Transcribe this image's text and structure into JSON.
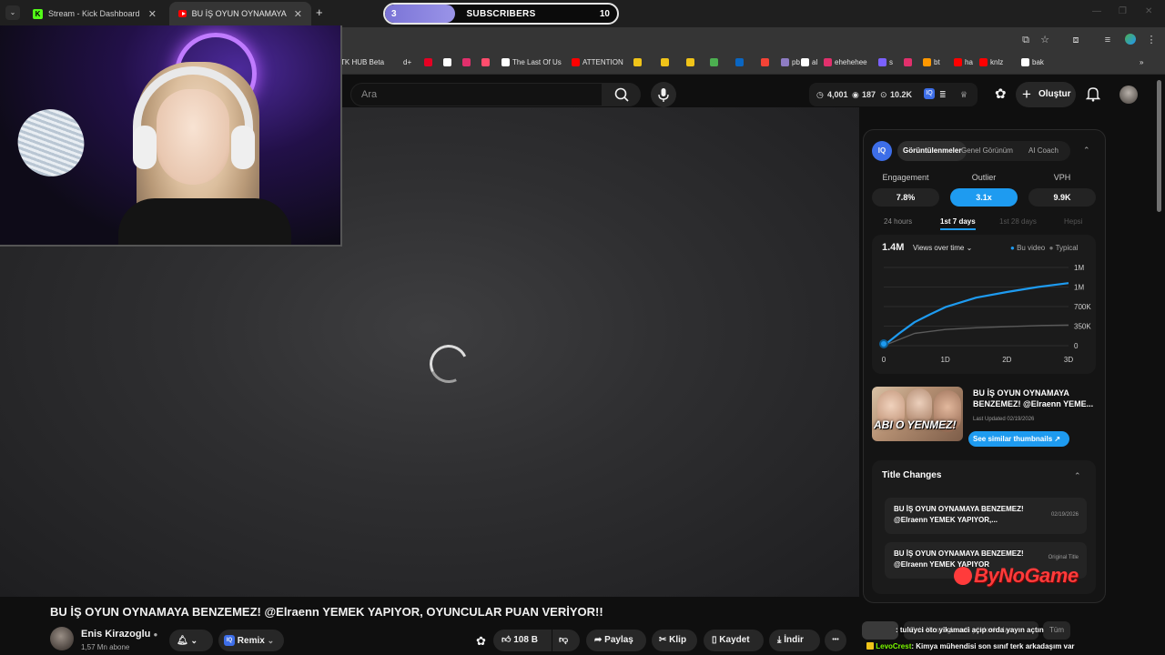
{
  "browser": {
    "tabs": [
      {
        "title": "Stream - Kick Dashboard",
        "icon": "kick-icon"
      },
      {
        "title": "BU İŞ OYUN OYNAMAYA BENZE",
        "icon": "youtube-icon"
      }
    ],
    "new_tab": "+",
    "bookmarks": [
      {
        "label": "TK HUB Beta",
        "color": ""
      },
      {
        "label": "d+",
        "color": ""
      },
      {
        "label": "",
        "color": "#e60023"
      },
      {
        "label": "",
        "color": "#ffffff"
      },
      {
        "label": "",
        "color": "#e1306c"
      },
      {
        "label": "",
        "color": "#ff4d6d"
      },
      {
        "label": "The Last Of Us",
        "color": "#ffffff"
      },
      {
        "label": "ATTENTION",
        "color": "#ff0000"
      },
      {
        "label": "",
        "color": "#f0c419"
      },
      {
        "label": "",
        "color": "#f0c419"
      },
      {
        "label": "",
        "color": "#f0c419"
      },
      {
        "label": "",
        "color": "#4caf50"
      },
      {
        "label": "",
        "color": "#0a66c2"
      },
      {
        "label": "",
        "color": "#f44336"
      },
      {
        "label": "pb",
        "color": "#8e7cc3"
      },
      {
        "label": "al",
        "color": "#ffffff"
      },
      {
        "label": "ehehehee",
        "color": "#e1306c"
      },
      {
        "label": "s",
        "color": "#7b61ff"
      },
      {
        "label": "",
        "color": "#e1306c"
      },
      {
        "label": "bt",
        "color": "#ff9800"
      },
      {
        "label": "ha",
        "color": "#ff0000"
      },
      {
        "label": "knlz",
        "color": "#ff0000"
      },
      {
        "label": "bak",
        "color": "#ffffff"
      }
    ]
  },
  "subscriber_goal": {
    "current": "3",
    "label": "SUBSCRIBERS",
    "goal": "10",
    "progress": 0.3
  },
  "youtube": {
    "search_placeholder": "Ara",
    "stats": {
      "a": "4,001",
      "b": "187",
      "c": "10.2K"
    },
    "create_label": "Oluştur",
    "video_title": "BU İŞ OYUN OYNAMAYA BENZEMEZ! @Elraenn YEMEK YAPIYOR, OYUNCULAR PUAN VERİYOR!!",
    "channel": {
      "name": "Enis Kirazoglu",
      "subs": "1,57 Mn abone"
    },
    "actions": {
      "remix": "Remix",
      "likes": "108 B",
      "share": "Paylaş",
      "clip": "Klip",
      "save": "Kaydet",
      "download": "İndir",
      "more": "•••"
    }
  },
  "panel": {
    "logo": "IQ",
    "tabs": [
      "Görüntülenmeler",
      "Genel Görünüm",
      "AI Coach"
    ],
    "metrics": [
      {
        "label": "Engagement",
        "value": "7.8%"
      },
      {
        "label": "Outlier",
        "value": "3.1x"
      },
      {
        "label": "VPH",
        "value": "9.9K"
      }
    ],
    "ranges": [
      "24 hours",
      "1st 7 days",
      "1st 28 days",
      "Hepsi"
    ],
    "chart_header": {
      "total": "1.4M",
      "selector": "Views over time",
      "legend": [
        "Bu video",
        "Typical"
      ]
    },
    "thumbnail_text": "ABI O YENMEZ!",
    "video_title": "BU İŞ OYUN OYNAMAYA BENZEMEZ! @Elraenn YEME...",
    "last_updated": "Last Updated 02/19/2026",
    "similar_button": "See similar thumbnails",
    "title_changes": {
      "heading": "Title Changes",
      "items": [
        {
          "title": "BU İŞ OYUN OYNAMAYA BENZEMEZ! @Elraenn YEMEK YAPIYOR,...",
          "date": "02/19/2026"
        },
        {
          "title": "BU İŞ OYUN OYNAMAYA BENZEMEZ! @Elraenn YEMEK YAPIYOR",
          "date": "Original Title"
        }
      ]
    }
  },
  "chart_data": {
    "type": "line",
    "title": "",
    "xlabel": "",
    "ylabel": "",
    "x_ticks": [
      "0",
      "1D",
      "2D",
      "3D"
    ],
    "y_ticks": [
      "1M",
      "1M",
      "700K",
      "350K",
      "0"
    ],
    "xlim": [
      0,
      3
    ],
    "ylim": [
      0,
      1400000
    ],
    "series": [
      {
        "name": "Bu video",
        "color": "#1e9bf0",
        "x": [
          0,
          0.25,
          0.5,
          0.75,
          1,
          1.5,
          2,
          2.5,
          3
        ],
        "y": [
          0,
          220000,
          420000,
          560000,
          690000,
          860000,
          960000,
          1050000,
          1120000
        ]
      },
      {
        "name": "Typical",
        "color": "#5a5a5a",
        "x": [
          0,
          0.5,
          1,
          1.5,
          2,
          2.5,
          3
        ],
        "y": [
          0,
          220000,
          290000,
          320000,
          340000,
          360000,
          370000
        ]
      }
    ],
    "grid": true,
    "legend": "top-right"
  },
  "watermark": "ByNoGame",
  "chat": [
    {
      "user": "",
      "message": ": tuluyci oto yikamaci açıp orda yayın açtın"
    },
    {
      "user": "LevoCrest",
      "message": ": Kimya mühendisi son sınıf terk arkadaşım var"
    }
  ],
  "related_search": "Enis Kirazoglu adlı yüklenicidan",
  "related_tab": "Tüm"
}
